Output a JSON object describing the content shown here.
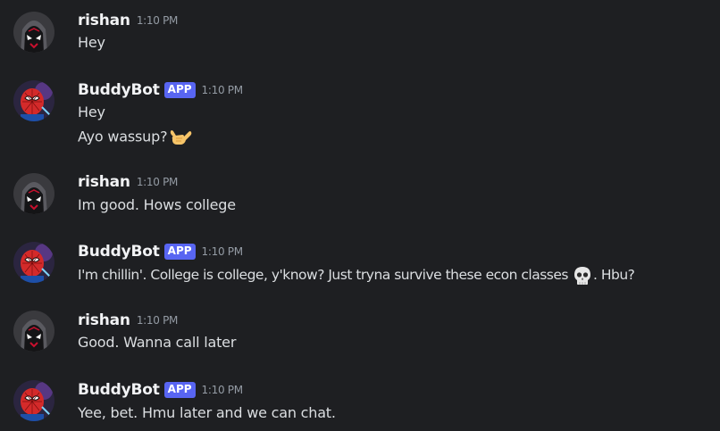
{
  "messages": [
    {
      "author": "rishan",
      "is_app": false,
      "timestamp": "1:10 PM",
      "avatar_icon": "spiderman-miles-avatar-icon",
      "lines": [
        {
          "text": "Hey",
          "emoji": null
        }
      ]
    },
    {
      "author": "BuddyBot",
      "is_app": true,
      "badge": "APP",
      "timestamp": "1:10 PM",
      "avatar_icon": "spiderman-avatar-icon",
      "lines": [
        {
          "text": "Hey",
          "emoji": null
        },
        {
          "text": "Ayo wassup?",
          "emoji": "call-me-hand-emoji"
        }
      ]
    },
    {
      "author": "rishan",
      "is_app": false,
      "timestamp": "1:10 PM",
      "avatar_icon": "spiderman-miles-avatar-icon",
      "lines": [
        {
          "text": "Im good. Hows college",
          "emoji": null
        }
      ]
    },
    {
      "author": "BuddyBot",
      "is_app": true,
      "badge": "APP",
      "timestamp": "1:10 PM",
      "avatar_icon": "spiderman-avatar-icon",
      "lines": [
        {
          "text": "I'm chillin'. College is college, y'know? Just tryna survive these econ classes",
          "emoji": "skull-emoji",
          "after_emoji": ". Hbu?"
        }
      ]
    },
    {
      "author": "rishan",
      "is_app": false,
      "timestamp": "1:10 PM",
      "avatar_icon": "spiderman-miles-avatar-icon",
      "lines": [
        {
          "text": "Good. Wanna call later",
          "emoji": null
        }
      ]
    },
    {
      "author": "BuddyBot",
      "is_app": true,
      "badge": "APP",
      "timestamp": "1:10 PM",
      "avatar_icon": "spiderman-avatar-icon",
      "lines": [
        {
          "text": "Yee, bet. Hmu later and we can chat.",
          "emoji": null
        }
      ]
    }
  ],
  "colors": {
    "background": "#1e1f22",
    "username": "#f2f3f5",
    "message_text": "#dbdee1",
    "timestamp": "#949ba4",
    "app_badge": "#5865f2"
  }
}
